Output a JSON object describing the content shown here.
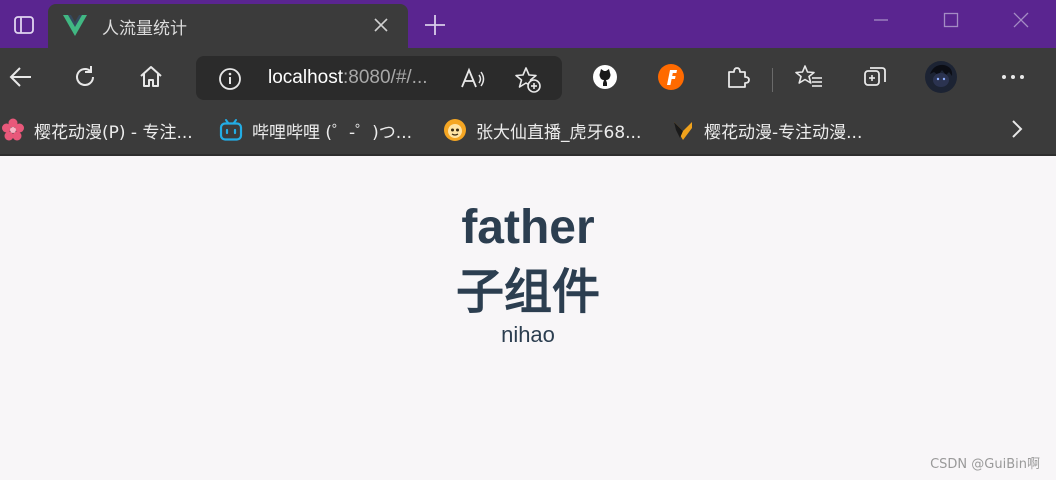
{
  "browser": {
    "tab": {
      "title": "人流量统计",
      "favicon": "vue-logo-icon"
    },
    "address": {
      "host": "localhost",
      "path": ":8080/#/..."
    },
    "colors": {
      "titlebar": "#5a2590",
      "toolbar": "#3b3b3b",
      "vue_green": "#41b883"
    }
  },
  "bookmarks": [
    {
      "label": "樱花动漫(P) - 专注...",
      "icon": "sakura-flower-icon"
    },
    {
      "label": "哔哩哔哩 (゜-゜)つ...",
      "icon": "bilibili-tv-icon"
    },
    {
      "label": "张大仙直播_虎牙68...",
      "icon": "huya-live-icon"
    },
    {
      "label": "樱花动漫-专注动漫...",
      "icon": "sakura-site-icon"
    }
  ],
  "page": {
    "heading": "father",
    "subheading": "子组件",
    "text": "nihao"
  },
  "watermark": "CSDN @GuiBin啊"
}
